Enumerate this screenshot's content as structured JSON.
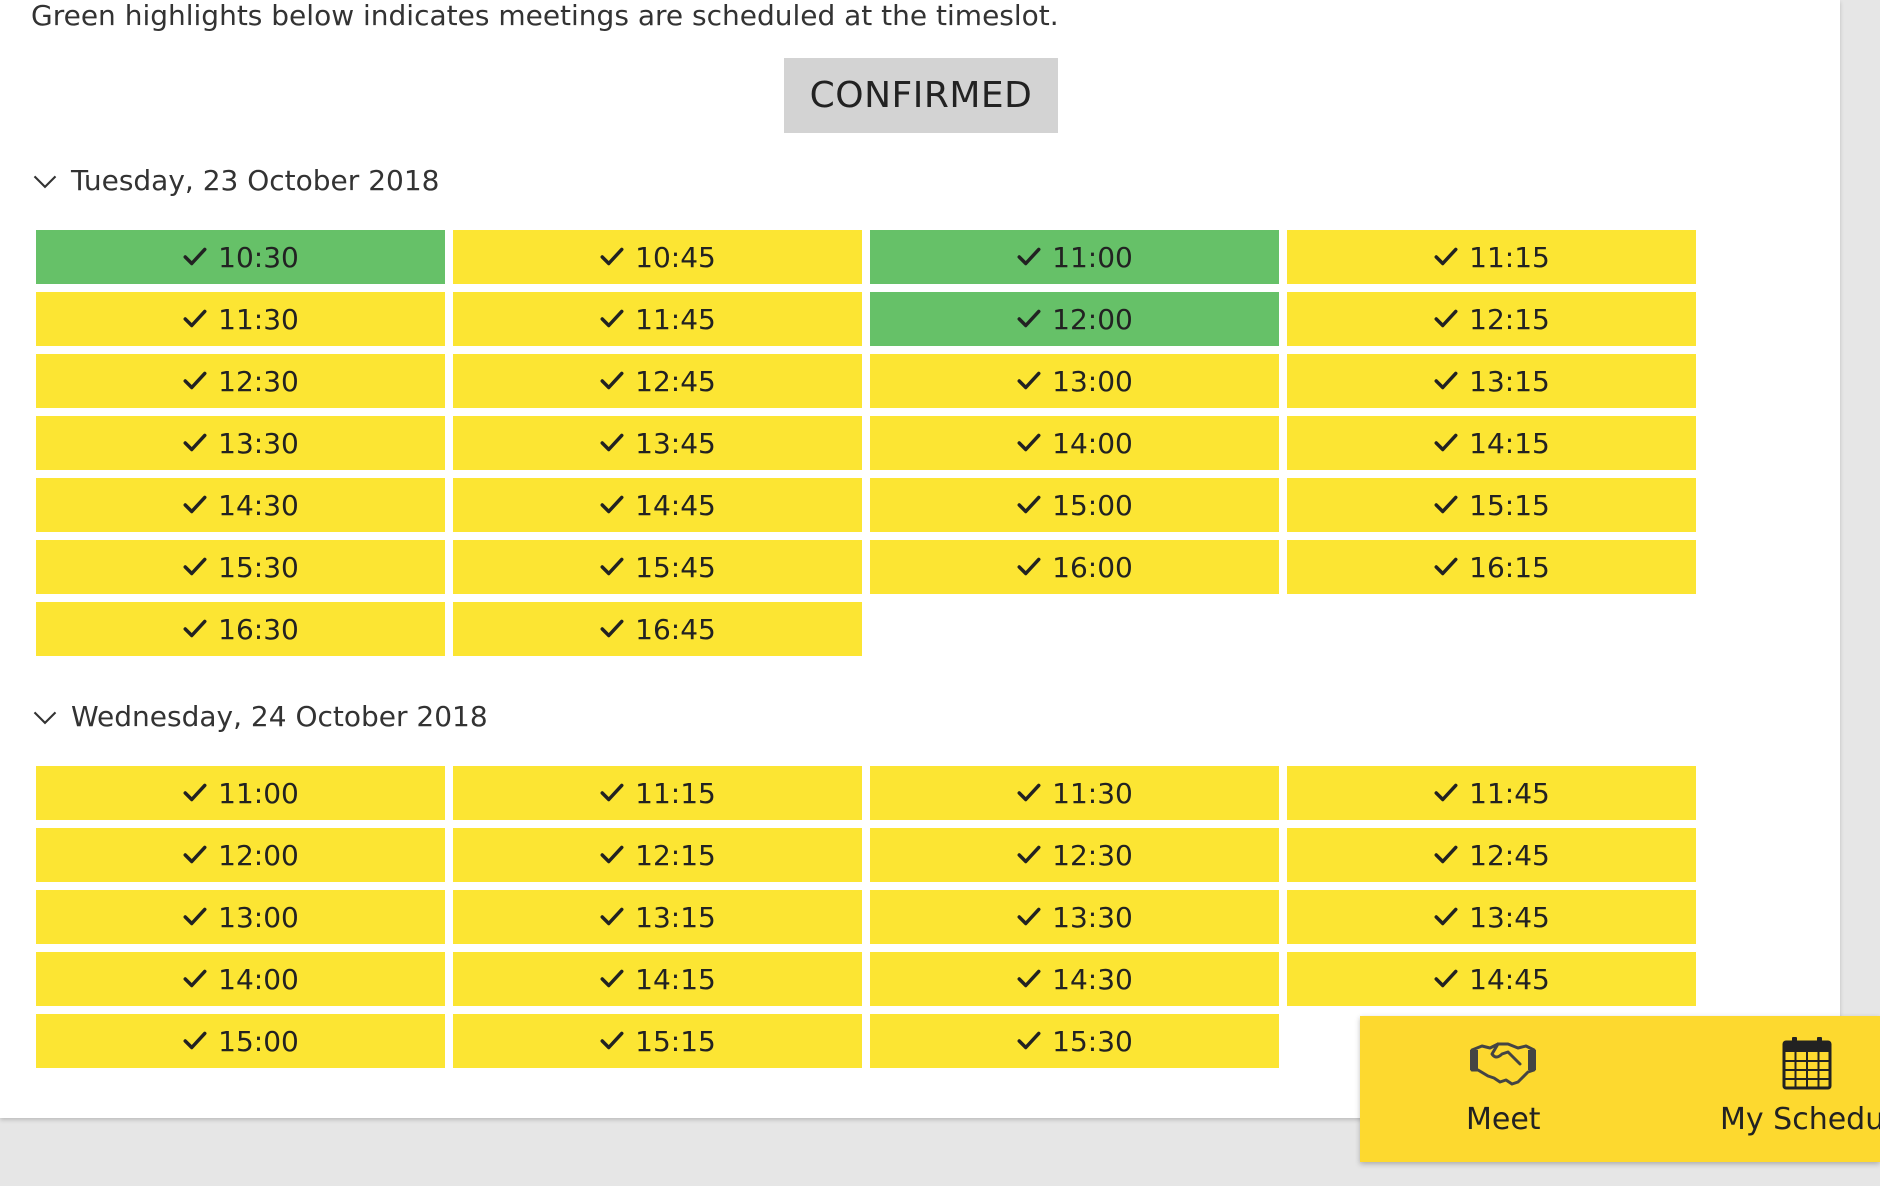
{
  "hint_text": "Green highlights below indicates meetings are scheduled at the timeslot.",
  "status_button": "CONFIRMED",
  "colors": {
    "available": "#fce533",
    "scheduled": "#66c168",
    "status_button_bg": "#d3d3d3",
    "nav_bg": "#fdd92f"
  },
  "days": [
    {
      "label": "Tuesday, 23 October 2018",
      "slots": [
        {
          "time": "10:30",
          "scheduled": true
        },
        {
          "time": "10:45",
          "scheduled": false
        },
        {
          "time": "11:00",
          "scheduled": true
        },
        {
          "time": "11:15",
          "scheduled": false
        },
        {
          "time": "11:30",
          "scheduled": false
        },
        {
          "time": "11:45",
          "scheduled": false
        },
        {
          "time": "12:00",
          "scheduled": true
        },
        {
          "time": "12:15",
          "scheduled": false
        },
        {
          "time": "12:30",
          "scheduled": false
        },
        {
          "time": "12:45",
          "scheduled": false
        },
        {
          "time": "13:00",
          "scheduled": false
        },
        {
          "time": "13:15",
          "scheduled": false
        },
        {
          "time": "13:30",
          "scheduled": false
        },
        {
          "time": "13:45",
          "scheduled": false
        },
        {
          "time": "14:00",
          "scheduled": false
        },
        {
          "time": "14:15",
          "scheduled": false
        },
        {
          "time": "14:30",
          "scheduled": false
        },
        {
          "time": "14:45",
          "scheduled": false
        },
        {
          "time": "15:00",
          "scheduled": false
        },
        {
          "time": "15:15",
          "scheduled": false
        },
        {
          "time": "15:30",
          "scheduled": false
        },
        {
          "time": "15:45",
          "scheduled": false
        },
        {
          "time": "16:00",
          "scheduled": false
        },
        {
          "time": "16:15",
          "scheduled": false
        },
        {
          "time": "16:30",
          "scheduled": false
        },
        {
          "time": "16:45",
          "scheduled": false
        }
      ]
    },
    {
      "label": "Wednesday, 24 October 2018",
      "slots": [
        {
          "time": "11:00",
          "scheduled": false
        },
        {
          "time": "11:15",
          "scheduled": false
        },
        {
          "time": "11:30",
          "scheduled": false
        },
        {
          "time": "11:45",
          "scheduled": false
        },
        {
          "time": "12:00",
          "scheduled": false
        },
        {
          "time": "12:15",
          "scheduled": false
        },
        {
          "time": "12:30",
          "scheduled": false
        },
        {
          "time": "12:45",
          "scheduled": false
        },
        {
          "time": "13:00",
          "scheduled": false
        },
        {
          "time": "13:15",
          "scheduled": false
        },
        {
          "time": "13:30",
          "scheduled": false
        },
        {
          "time": "13:45",
          "scheduled": false
        },
        {
          "time": "14:00",
          "scheduled": false
        },
        {
          "time": "14:15",
          "scheduled": false
        },
        {
          "time": "14:30",
          "scheduled": false
        },
        {
          "time": "14:45",
          "scheduled": false
        },
        {
          "time": "15:00",
          "scheduled": false
        },
        {
          "time": "15:15",
          "scheduled": false
        },
        {
          "time": "15:30",
          "scheduled": false
        }
      ]
    }
  ],
  "bottom_nav": {
    "meet_label": "Meet",
    "meet_icon": "handshake-icon",
    "schedule_label": "My Schedul",
    "schedule_icon": "calendar-icon"
  }
}
